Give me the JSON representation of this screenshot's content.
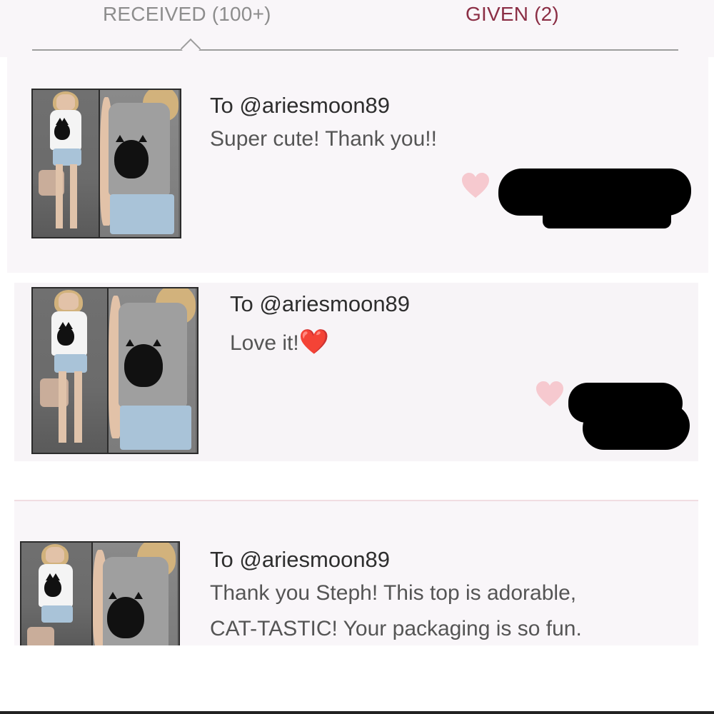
{
  "tabs": {
    "received_label": "RECEIVED (100+)",
    "given_label": "GIVEN (2)"
  },
  "reviews": [
    {
      "to": "To @ariesmoon89",
      "message": "Super cute! Thank you!!"
    },
    {
      "to": "To @ariesmoon89",
      "message": "Love it!",
      "emoji": "❤️"
    },
    {
      "to": "To @ariesmoon89",
      "message_line1": "Thank you Steph! This top is adorable,",
      "message_line2": "CAT-TASTIC! Your packaging is so fun."
    }
  ],
  "colors": {
    "given_accent": "#8b2e45",
    "heart": "#f6c9cf"
  }
}
